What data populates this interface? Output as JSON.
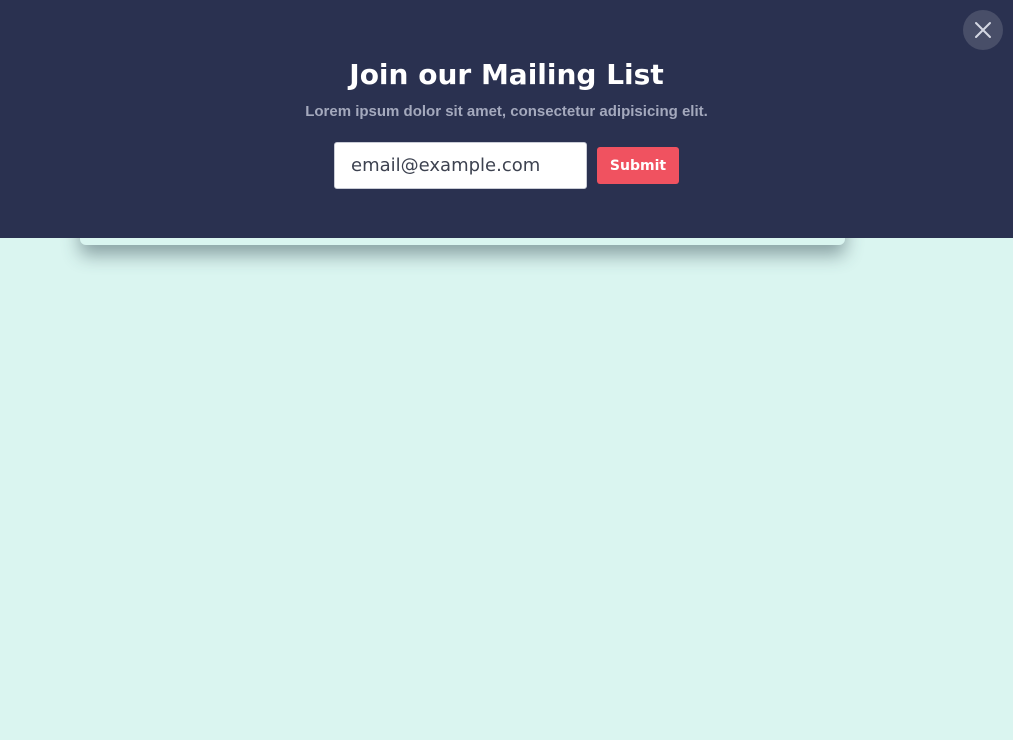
{
  "colors": {
    "banner_background": "#2a3150",
    "page_background": "#daf5f0",
    "accent": "#f05260",
    "subtitle_text": "#a4a9bd",
    "title_text": "#ffffff"
  },
  "banner": {
    "close_icon": "close-icon",
    "title": "Join our Mailing List",
    "subtitle": "Lorem ipsum dolor sit amet, consectetur adipisicing elit.",
    "form": {
      "email_placeholder": "email@example.com",
      "submit_label": "Submit"
    }
  }
}
